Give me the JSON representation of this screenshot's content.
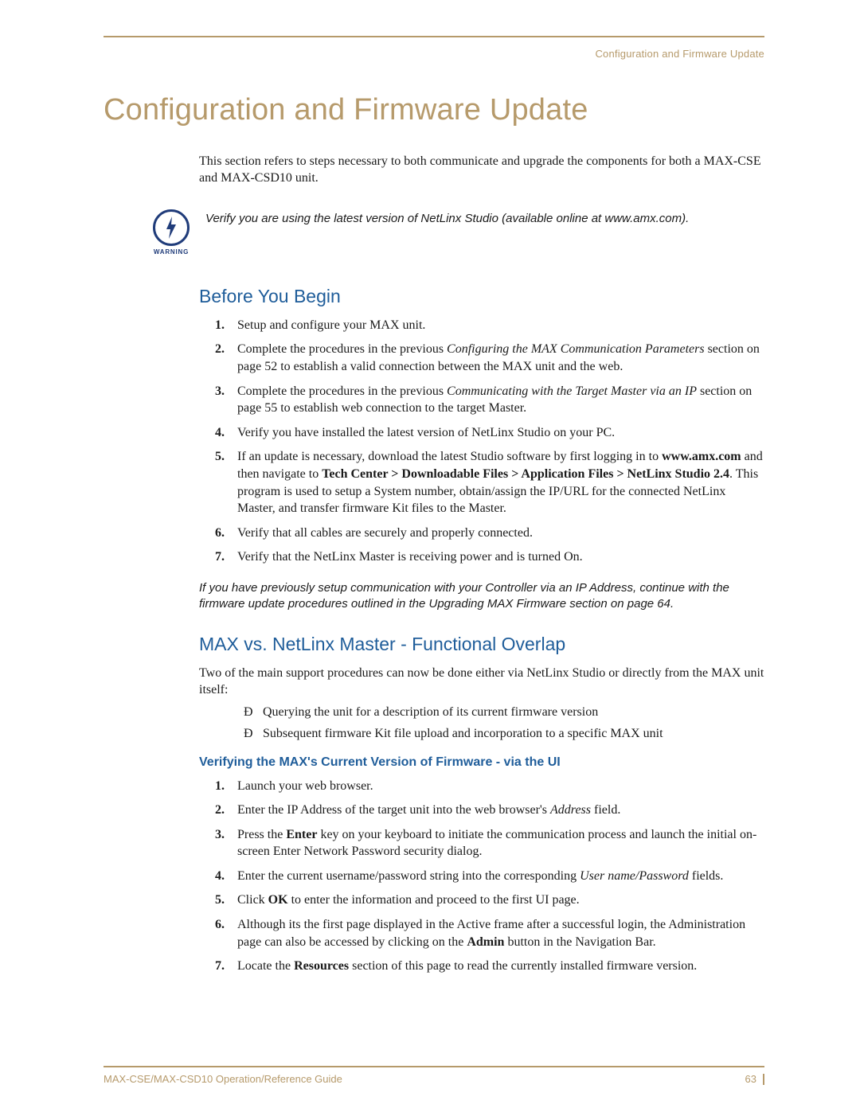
{
  "running_head": "Configuration and Firmware Update",
  "title": "Configuration and Firmware Update",
  "intro": "This section refers to steps necessary to both communicate and upgrade the components for both a MAX-CSE and MAX-CSD10 unit.",
  "warning": {
    "label": "WARNING",
    "text": "Verify you are using the latest version of NetLinx Studio (available online at www.amx.com)."
  },
  "before": {
    "heading": "Before You Begin",
    "items": {
      "i1": "Setup and configure your MAX unit.",
      "i2_a": "Complete the procedures in the previous ",
      "i2_b": "Configuring the MAX Communication Parameters",
      "i2_c": " section on page 52 to establish a valid connection between the MAX unit and the web.",
      "i3_a": "Complete the procedures in the previous ",
      "i3_b": "Communicating with the Target Master via an IP",
      "i3_c": " section on page 55 to establish web connection to the target Master.",
      "i4": "Verify you have installed the latest version of NetLinx Studio on your PC.",
      "i5_a": "If an update is necessary, download the latest Studio software by first logging in to ",
      "i5_b": "www.amx.com",
      "i5_c": " and then navigate to ",
      "i5_d": "Tech Center > Downloadable Files > Application Files > NetLinx Studio 2.4",
      "i5_e": ". This program is used to setup a System number, obtain/assign the IP/URL for the connected NetLinx Master, and transfer firmware Kit files to the Master.",
      "i6": "Verify that all cables are securely and properly connected.",
      "i7": "Verify that the NetLinx Master is receiving power and is turned On."
    },
    "note": "If you have previously setup communication with your Controller via an IP Address, continue with the firmware update procedures outlined in the Upgrading MAX Firmware section on page 64."
  },
  "overlap": {
    "heading": "MAX vs. NetLinx Master - Functional Overlap",
    "intro": "Two of the main support procedures can now be done either via NetLinx Studio or directly from the MAX unit itself:",
    "bullets": {
      "b1": "Querying the unit for a description of its current firmware version",
      "b2": "Subsequent firmware Kit file upload and incorporation to a specific MAX unit"
    },
    "sub_heading": "Verifying the MAX's Current Version of Firmware - via the UI",
    "steps": {
      "s1": "Launch your web browser.",
      "s2_a": "Enter the IP Address of the target unit into the web browser's ",
      "s2_b": "Address",
      "s2_c": " field.",
      "s3_a": "Press the ",
      "s3_b": "Enter",
      "s3_c": " key on your keyboard to initiate the communication process and launch the initial on-screen Enter Network Password security dialog.",
      "s4_a": "Enter the current username/password string into the corresponding ",
      "s4_b": "User name/Password",
      "s4_c": " fields.",
      "s5_a": "Click ",
      "s5_b": "OK",
      "s5_c": " to enter the information and proceed to the first UI page.",
      "s6_a": "Although its the first page displayed in the Active frame after a successful login, the Administration page can also be accessed by clicking on the ",
      "s6_b": "Admin",
      "s6_c": " button in the Navigation Bar.",
      "s7_a": "Locate the ",
      "s7_b": "Resources",
      "s7_c": " section of this page to read the currently installed firmware version."
    }
  },
  "footer": {
    "doc": "MAX-CSE/MAX-CSD10 Operation/Reference Guide",
    "page": "63"
  }
}
